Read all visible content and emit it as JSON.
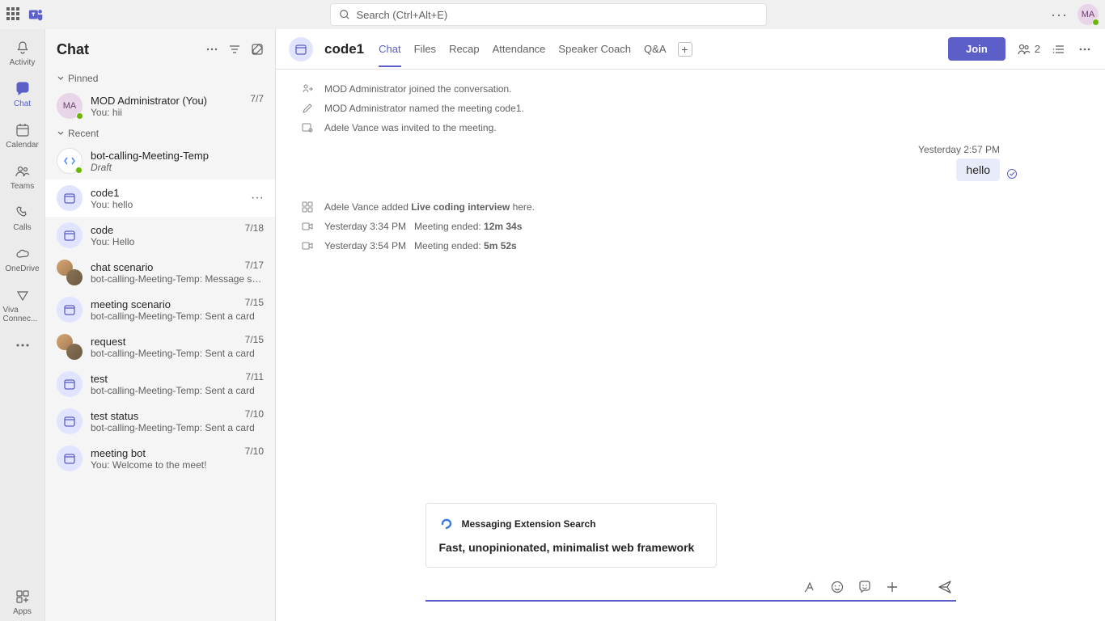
{
  "search": {
    "placeholder": "Search (Ctrl+Alt+E)"
  },
  "avatar_initials": "MA",
  "rail": [
    {
      "label": "Activity"
    },
    {
      "label": "Chat"
    },
    {
      "label": "Calendar"
    },
    {
      "label": "Teams"
    },
    {
      "label": "Calls"
    },
    {
      "label": "OneDrive"
    },
    {
      "label": "Viva Connec..."
    },
    {
      "label": "Apps"
    }
  ],
  "chatlist": {
    "title": "Chat",
    "sections": {
      "pinned_label": "Pinned",
      "recent_label": "Recent"
    },
    "pinned": [
      {
        "title": "MOD Administrator (You)",
        "sub": "You: hii",
        "date": "7/7",
        "avatar_text": "MA",
        "avatar_type": "ma"
      }
    ],
    "recent": [
      {
        "title": "bot-calling-Meeting-Temp",
        "sub": "Draft",
        "date": "",
        "avatar_type": "code",
        "italic": true
      },
      {
        "title": "code1",
        "sub": "You: hello",
        "date": "",
        "avatar_type": "cal",
        "selected": true
      },
      {
        "title": "code",
        "sub": "You: Hello",
        "date": "7/18",
        "avatar_type": "cal"
      },
      {
        "title": "chat scenario",
        "sub": "bot-calling-Meeting-Temp: Message sent: 0",
        "date": "7/17",
        "avatar_type": "people"
      },
      {
        "title": "meeting scenario",
        "sub": "bot-calling-Meeting-Temp: Sent a card",
        "date": "7/15",
        "avatar_type": "cal"
      },
      {
        "title": "request",
        "sub": "bot-calling-Meeting-Temp: Sent a card",
        "date": "7/15",
        "avatar_type": "people"
      },
      {
        "title": "test",
        "sub": "bot-calling-Meeting-Temp: Sent a card",
        "date": "7/11",
        "avatar_type": "cal"
      },
      {
        "title": "test status",
        "sub": "bot-calling-Meeting-Temp: Sent a card",
        "date": "7/10",
        "avatar_type": "cal"
      },
      {
        "title": "meeting bot",
        "sub": "You: Welcome to the meet!",
        "date": "7/10",
        "avatar_type": "cal"
      }
    ]
  },
  "header": {
    "title": "code1",
    "tabs": [
      "Chat",
      "Files",
      "Recap",
      "Attendance",
      "Speaker Coach",
      "Q&A"
    ],
    "join_label": "Join",
    "people_count": "2"
  },
  "thread": {
    "sys": [
      "MOD Administrator joined the conversation.",
      "MOD Administrator named the meeting code1.",
      "Adele Vance was invited to the meeting."
    ],
    "timestamp": "Yesterday 2:57 PM",
    "message": "hello",
    "added_prefix": "Adele Vance added ",
    "added_item": "Live coding interview",
    "added_suffix": " here.",
    "ended1_time": "Yesterday 3:34 PM",
    "ended1_label": "Meeting ended: ",
    "ended1_dur": "12m 34s",
    "ended2_time": "Yesterday 3:54 PM",
    "ended2_label": "Meeting ended: ",
    "ended2_dur": "5m 52s"
  },
  "card": {
    "header": "Messaging Extension Search",
    "body": "Fast, unopinionated, minimalist web framework"
  }
}
